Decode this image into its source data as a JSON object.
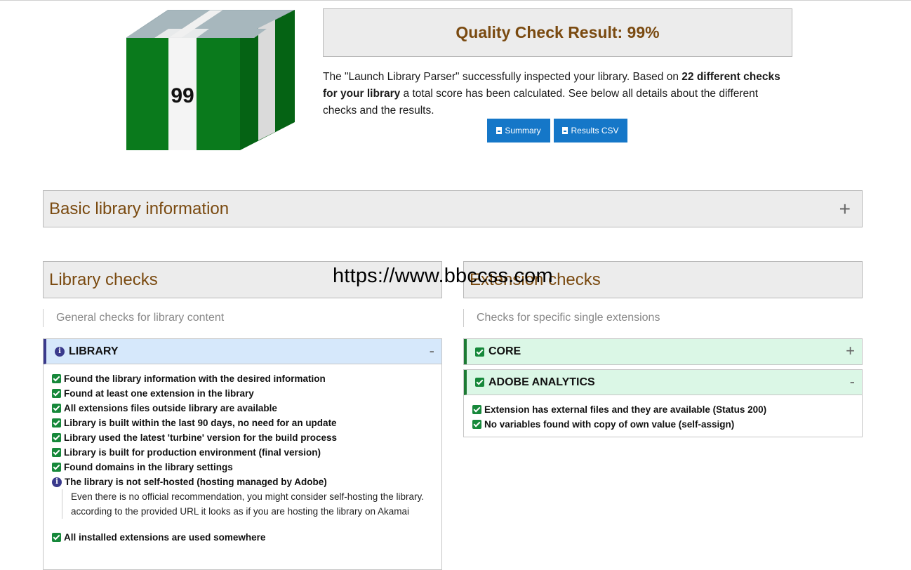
{
  "score": {
    "value": "99",
    "title": "Quality Check Result: 99%",
    "text_part1": "The \"Launch Library Parser\" successfully inspected your library. Based on ",
    "text_bold": "22 different checks for your library",
    "text_part2": " a total score has been calculated. See below all details about the different checks and the results.",
    "colors": {
      "cube_green": "#0a7a1c",
      "cube_dark": "#056314",
      "top": "#a7b7bd"
    }
  },
  "buttons": {
    "summary": "Summary",
    "csv": "Results CSV"
  },
  "basic_info": {
    "title": "Basic library information",
    "toggle": "+"
  },
  "watermark": "https://www.bbccss.com",
  "library_checks": {
    "title": "Library checks",
    "subtitle": "General checks for library content",
    "panel": {
      "title": "LIBRARY",
      "toggle": "-",
      "items": [
        "Found the library information with the desired information",
        "Found at least one extension in the library",
        "All extensions files outside library are available",
        "Library is built within the last 90 days, no need for an update",
        "Library used the latest 'turbine' version for the build process",
        "Library is built for production environment (final version)",
        "Found domains in the library settings"
      ],
      "info_item": "The library is not self-hosted (hosting managed by Adobe)",
      "info_note": "Even there is no official recommendation, you might consider self-hosting the library. according to the provided URL it looks as if you are hosting the library on Akamai",
      "last_item": "All installed extensions are used somewhere"
    }
  },
  "extension_checks": {
    "title": "Extension checks",
    "subtitle": "Checks for specific single extensions",
    "core": {
      "title": "CORE",
      "toggle": "+"
    },
    "adobe_analytics": {
      "title": "ADOBE ANALYTICS",
      "toggle": "-",
      "items": [
        "Extension has external files and they are available (Status 200)",
        "No variables found with copy of own value (self-assign)"
      ]
    }
  }
}
